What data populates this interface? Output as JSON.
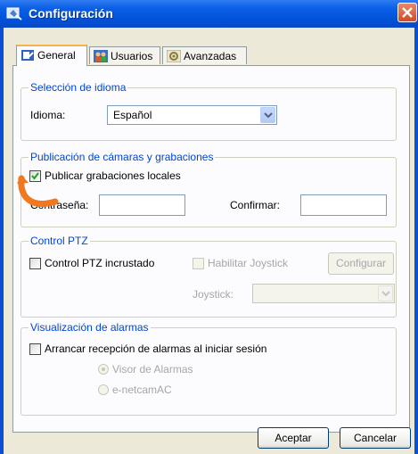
{
  "window": {
    "title": "Configuración"
  },
  "tabs": [
    {
      "label": "General",
      "active": true,
      "icon": "general-settings-icon"
    },
    {
      "label": "Usuarios",
      "active": false,
      "icon": "users-icon"
    },
    {
      "label": "Avanzadas",
      "active": false,
      "icon": "advanced-settings-icon"
    }
  ],
  "language": {
    "group_title": "Selección de idioma",
    "label": "Idioma:",
    "selected": "Español"
  },
  "publish": {
    "group_title": "Publicación de cámaras y grabaciones",
    "checkbox_label": "Publicar grabaciones locales",
    "checked": true,
    "password_label": "Contraseña:",
    "password_value": "",
    "confirm_label": "Confirmar:",
    "confirm_value": ""
  },
  "ptz": {
    "group_title": "Control PTZ",
    "embedded_label": "Control PTZ incrustado",
    "joystick_enable_label": "Habilitar Joystick",
    "configure_label": "Configurar",
    "joystick_label": "Joystick:",
    "joystick_selected": ""
  },
  "alarms": {
    "group_title": "Visualización de alarmas",
    "startup_label": "Arrancar recepción de alarmas al iniciar sesión",
    "options": [
      "Visor de Alarmas",
      "e-netcamAC"
    ]
  },
  "footer": {
    "ok_label": "Aceptar",
    "cancel_label": "Cancelar"
  },
  "colors": {
    "titlebar": "#0052d9",
    "group_title": "#0046d5",
    "annotation_arrow": "#f07820",
    "face": "#ece9d8"
  }
}
